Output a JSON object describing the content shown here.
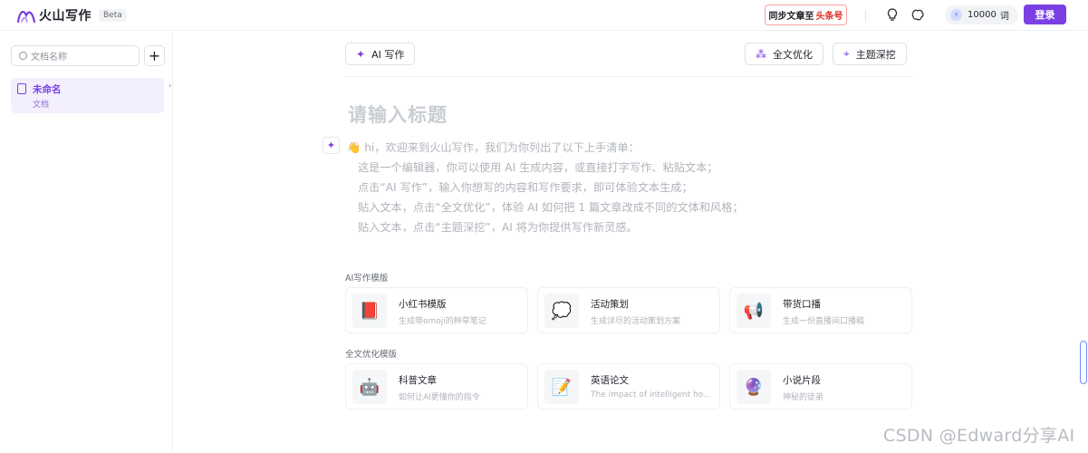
{
  "header": {
    "app_name": "火山写作",
    "beta_badge": "Beta",
    "sync_prefix": "同步文章至",
    "sync_target": "头条号",
    "credits_value": "10000",
    "credits_unit": "词",
    "login_label": "登录",
    "accent_color": "#7b3fe4"
  },
  "sidebar": {
    "search_placeholder": "文档名称",
    "add_label": "+",
    "collapse_glyph": "‹",
    "docs": [
      {
        "title": "未命名",
        "subtitle": "文档"
      }
    ]
  },
  "toolbar": {
    "ai_write_label": "AI 写作",
    "optimize_label": "全文优化",
    "topic_label": "主题深挖"
  },
  "editor": {
    "title_placeholder": "请输入标题",
    "intro_first": "hi，欢迎来到火山写作，我们为你列出了以下上手清单：",
    "intro_lines": [
      "这是一个编辑器，你可以使用 AI 生成内容，或直接打字写作、粘贴文本；",
      "点击“AI 写作”，输入你想写的内容和写作要求，即可体验文本生成；",
      "贴入文本，点击“全文优化”，体验 AI 如何把 1 篇文章改成不同的文体和风格；",
      "贴入文本，点击“主题深挖”，AI 将为你提供写作新灵感。"
    ]
  },
  "templates": {
    "ai_section_label": "AI写作模版",
    "ai_cards": [
      {
        "name": "小红书模版",
        "desc": "生成带emoji的种草笔记",
        "icon": "book-icon"
      },
      {
        "name": "活动策划",
        "desc": "生成详尽的活动策划方案",
        "icon": "speech-bubble-icon"
      },
      {
        "name": "带货口播",
        "desc": "生成一份直播间口播稿",
        "icon": "megaphone-icon"
      }
    ],
    "opt_section_label": "全文优化模版",
    "opt_cards": [
      {
        "name": "科普文章",
        "desc": "如何让AI更懂你的指令",
        "icon": "robot-icon"
      },
      {
        "name": "英语论文",
        "desc": "The impact of intelligent hou···",
        "icon": "memo-icon"
      },
      {
        "name": "小说片段",
        "desc": "神秘的徒弟",
        "icon": "crystal-ball-icon"
      }
    ]
  },
  "watermark": "CSDN @Edward分享AI"
}
